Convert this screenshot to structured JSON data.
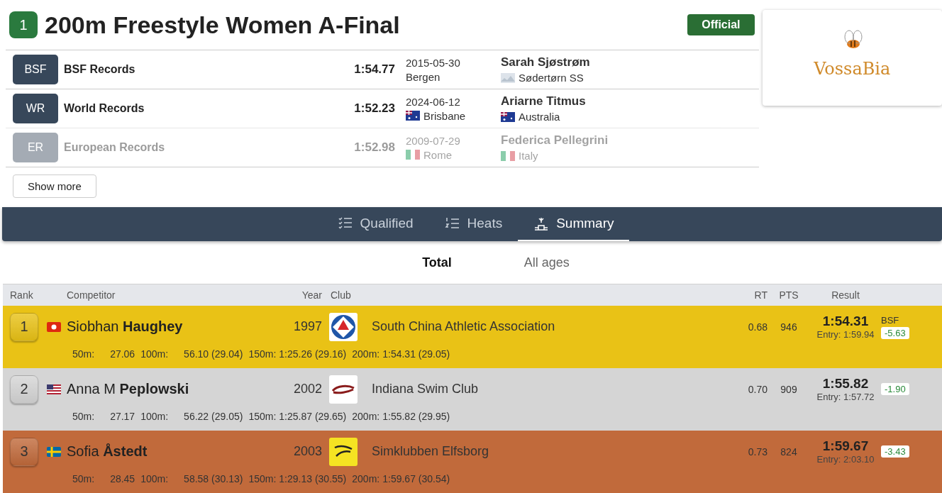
{
  "event": {
    "number": "1",
    "title": "200m Freestyle Women A-Final",
    "status": "Official"
  },
  "records": [
    {
      "code": "BSF",
      "name": "BSF Records",
      "time": "1:54.77",
      "date": "2015-05-30",
      "place": "Bergen",
      "holder": "Sarah Sjøstrøm",
      "team": "Sødertørn SS",
      "faded": false
    },
    {
      "code": "WR",
      "name": "World Records",
      "time": "1:52.23",
      "date": "2024-06-12",
      "place": "Brisbane",
      "holder": "Ariarne Titmus",
      "team": "Australia",
      "faded": false
    },
    {
      "code": "ER",
      "name": "European Records",
      "time": "1:52.98",
      "date": "2009-07-29",
      "place": "Rome",
      "holder": "Federica Pellegrini",
      "team": "Italy",
      "faded": true
    }
  ],
  "show_more": "Show more",
  "logo": {
    "text": "VossaBia"
  },
  "tabs": [
    {
      "label": "Qualified",
      "selected": false
    },
    {
      "label": "Heats",
      "selected": false
    },
    {
      "label": "Summary",
      "selected": true
    }
  ],
  "subtabs": [
    {
      "label": "Total",
      "selected": true
    },
    {
      "label": "All ages",
      "selected": false
    }
  ],
  "table": {
    "columns": [
      "Rank",
      "Competitor",
      "Year",
      "Club",
      "RT",
      "PTS",
      "Result"
    ],
    "rows": [
      {
        "rank": "1",
        "color": "#e9c216",
        "name": "Siobhan **Haughey**",
        "year": "1997",
        "club": "South China Athletic Association",
        "rt": "0.68",
        "pts": "946",
        "result": "1:54.31",
        "entry": "Entry: 1:59.94",
        "record": "BSF",
        "diff": "-5.63",
        "splits": [
          {
            "label": "50m:",
            "time": "27.06"
          },
          {
            "label": "100m:",
            "time": "56.10 (29.04)"
          },
          {
            "label": "150m:",
            "time": "1:25.26 (29.16)"
          },
          {
            "label": "200m:",
            "time": "1:54.31 (29.05)"
          }
        ]
      },
      {
        "rank": "2",
        "color": "#d5d5d5",
        "name": "Anna M **Peplowski**",
        "year": "2002",
        "club": "Indiana Swim Club",
        "rt": "0.70",
        "pts": "909",
        "result": "1:55.82",
        "entry": "Entry: 1:57.72",
        "diff": "-1.90",
        "splits": [
          {
            "label": "50m:",
            "time": "27.17"
          },
          {
            "label": "100m:",
            "time": "56.22 (29.05)"
          },
          {
            "label": "150m:",
            "time": "1:25.87 (29.65)"
          },
          {
            "label": "200m:",
            "time": "1:55.82 (29.95)"
          }
        ]
      },
      {
        "rank": "3",
        "color": "#c16a3b",
        "name": "Sofia **Åstedt**",
        "year": "2003",
        "club": "Simklubben Elfsborg",
        "rt": "0.73",
        "pts": "824",
        "result": "1:59.67",
        "entry": "Entry: 2:03.10",
        "diff": "-3.43",
        "splits": [
          {
            "label": "50m:",
            "time": "28.45"
          },
          {
            "label": "100m:",
            "time": "58.58 (30.13)"
          },
          {
            "label": "150m:",
            "time": "1:29.13 (30.55)"
          },
          {
            "label": "200m:",
            "time": "1:59.67 (30.54)"
          }
        ]
      }
    ]
  }
}
